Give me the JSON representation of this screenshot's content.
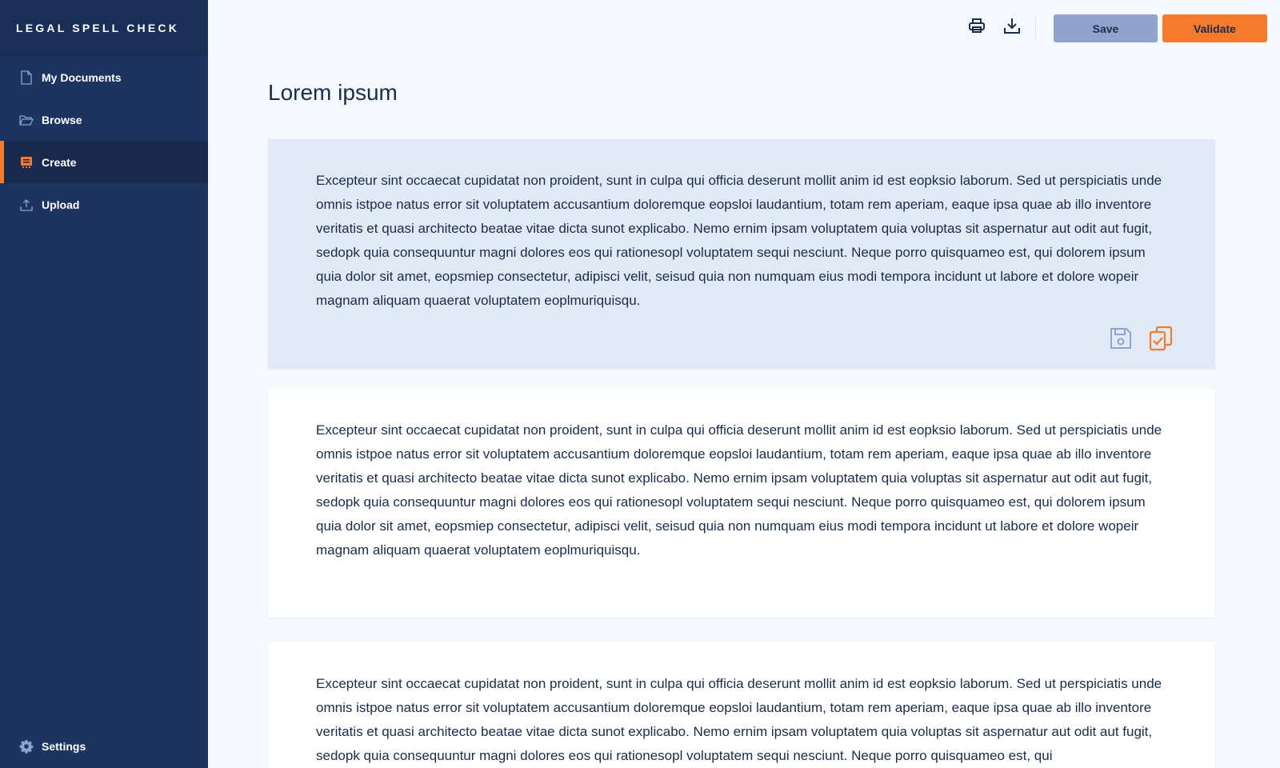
{
  "app": {
    "title": "LEGAL SPELL CHECK"
  },
  "sidebar": {
    "items": [
      {
        "label": "My Documents",
        "icon": "document-icon"
      },
      {
        "label": "Browse",
        "icon": "folder-open-icon"
      },
      {
        "label": "Create",
        "icon": "create-icon",
        "active": true
      },
      {
        "label": "Upload",
        "icon": "upload-icon"
      }
    ],
    "settings": {
      "label": "Settings",
      "icon": "gear-icon"
    }
  },
  "toolbar": {
    "print_icon": "print-icon",
    "download_icon": "download-icon",
    "save_label": "Save",
    "validate_label": "Validate"
  },
  "main": {
    "title": "Lorem ipsum",
    "paragraphs": [
      "Excepteur sint occaecat cupidatat non proident, sunt in culpa qui officia deserunt mollit anim id est eopksio laborum. Sed ut perspiciatis unde omnis istpoe natus error sit voluptatem accusantium doloremque eopsloi laudantium, totam rem aperiam, eaque ipsa quae ab illo inventore veritatis et quasi architecto beatae vitae dicta sunot explicabo. Nemo ernim ipsam voluptatem quia voluptas sit aspernatur aut odit aut fugit, sedopk quia consequuntur magni dolores eos qui rationesopl voluptatem sequi nesciunt. Neque porro quisquameo est, qui dolorem ipsum quia dolor sit amet, eopsmiep consectetur, adipisci velit, seisud quia non numquam eius modi tempora incidunt ut labore et dolore wopeir magnam aliquam quaerat voluptatem eoplmuriquisqu.",
      "Excepteur sint occaecat cupidatat non proident, sunt in culpa qui officia deserunt mollit anim id est eopksio laborum. Sed ut perspiciatis unde omnis istpoe natus error sit voluptatem accusantium doloremque eopsloi laudantium, totam rem aperiam, eaque ipsa quae ab illo inventore veritatis et quasi architecto beatae vitae dicta sunot explicabo. Nemo ernim ipsam voluptatem quia voluptas sit aspernatur aut odit aut fugit, sedopk quia consequuntur magni dolores eos qui rationesopl voluptatem sequi nesciunt. Neque porro quisquameo est, qui dolorem ipsum quia dolor sit amet, eopsmiep consectetur, adipisci velit, seisud quia non numquam eius modi tempora incidunt ut labore et dolore wopeir magnam aliquam quaerat voluptatem eoplmuriquisqu.",
      "Excepteur sint occaecat cupidatat non proident, sunt in culpa qui officia deserunt mollit anim id est eopksio laborum. Sed ut perspiciatis unde omnis istpoe natus error sit voluptatem accusantium doloremque eopsloi laudantium, totam rem aperiam, eaque ipsa quae ab illo inventore veritatis et quasi architecto beatae vitae dicta sunot explicabo. Nemo ernim ipsam voluptatem quia voluptas sit aspernatur aut odit aut fugit, sedopk quia consequuntur magni dolores eos qui rationesopl voluptatem sequi nesciunt. Neque porro quisquameo est, qui"
    ],
    "card_actions": [
      "save-icon",
      "clipboard-check-icon"
    ]
  },
  "colors": {
    "sidebar_bg": "#1d3461",
    "accent": "#f47a2c",
    "save_button": "#8fa3cc",
    "selected_card": "#e1e9f5"
  }
}
